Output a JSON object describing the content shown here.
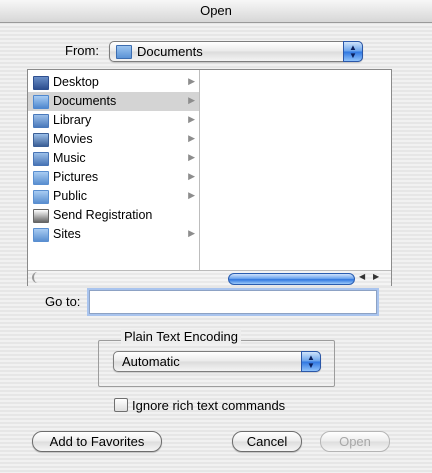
{
  "window": {
    "title": "Open"
  },
  "from": {
    "label": "From:",
    "selected": "Documents"
  },
  "browser": {
    "items": [
      {
        "label": "Desktop",
        "icon": "desktop-folder-icon",
        "selected": false,
        "has_children": true
      },
      {
        "label": "Documents",
        "icon": "documents-folder-icon",
        "selected": true,
        "has_children": true
      },
      {
        "label": "Library",
        "icon": "library-folder-icon",
        "selected": false,
        "has_children": true
      },
      {
        "label": "Movies",
        "icon": "movies-folder-icon",
        "selected": false,
        "has_children": true
      },
      {
        "label": "Music",
        "icon": "music-folder-icon",
        "selected": false,
        "has_children": true
      },
      {
        "label": "Pictures",
        "icon": "pictures-folder-icon",
        "selected": false,
        "has_children": true
      },
      {
        "label": "Public",
        "icon": "public-folder-icon",
        "selected": false,
        "has_children": true
      },
      {
        "label": "Send Registration",
        "icon": "alias-file-icon",
        "selected": false,
        "has_children": false
      },
      {
        "label": "Sites",
        "icon": "sites-folder-icon",
        "selected": false,
        "has_children": true
      }
    ]
  },
  "goto": {
    "label": "Go to:",
    "value": ""
  },
  "encoding": {
    "title": "Plain Text Encoding",
    "selected": "Automatic"
  },
  "ignore_rich": {
    "label": "Ignore rich text commands",
    "checked": false
  },
  "buttons": {
    "add_favorites": "Add to Favorites",
    "cancel": "Cancel",
    "open": "Open",
    "open_enabled": false
  },
  "colors": {
    "accent": "#2f76e0",
    "selection": "#d4d4d4"
  }
}
